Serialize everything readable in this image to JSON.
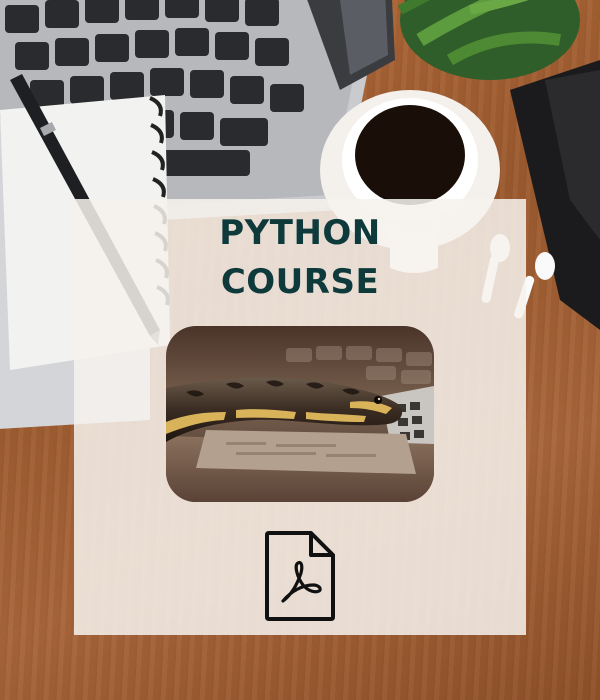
{
  "card": {
    "title_line_1": "PYTHON",
    "title_line_2": "COURSE"
  },
  "icons": {
    "document": "pdf-file-icon"
  },
  "colors": {
    "title_text": "#0f3a3c",
    "card_background": "#f6f2ee",
    "desk_wood": "#a8653a"
  }
}
